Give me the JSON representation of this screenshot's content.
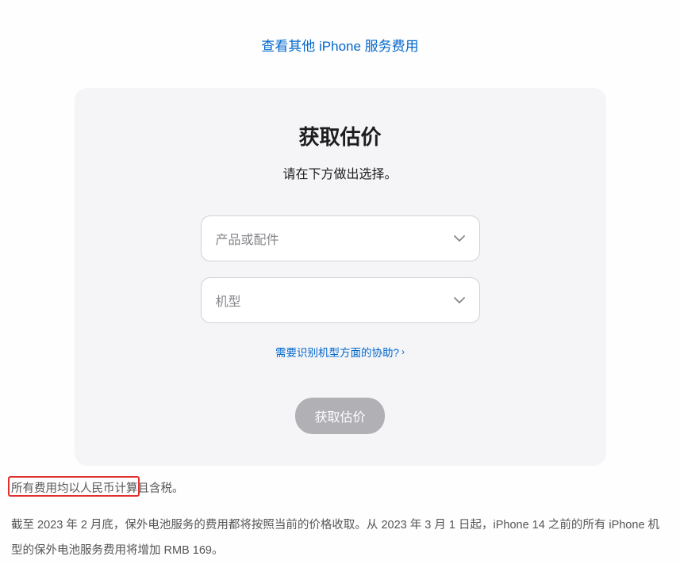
{
  "topLink": "查看其他 iPhone 服务费用",
  "card": {
    "title": "获取估价",
    "subtitle": "请在下方做出选择。",
    "select1Placeholder": "产品或配件",
    "select2Placeholder": "机型",
    "helpLink": "需要识别机型方面的协助?",
    "submitLabel": "获取估价"
  },
  "footer": {
    "line1": "所有费用均以人民币计算且含税。",
    "line2": "截至 2023 年 2 月底，保外电池服务的费用都将按照当前的价格收取。从 2023 年 3 月 1 日起，iPhone 14 之前的所有 iPhone 机型的保外电池服务费用将增加 RMB 169。"
  }
}
